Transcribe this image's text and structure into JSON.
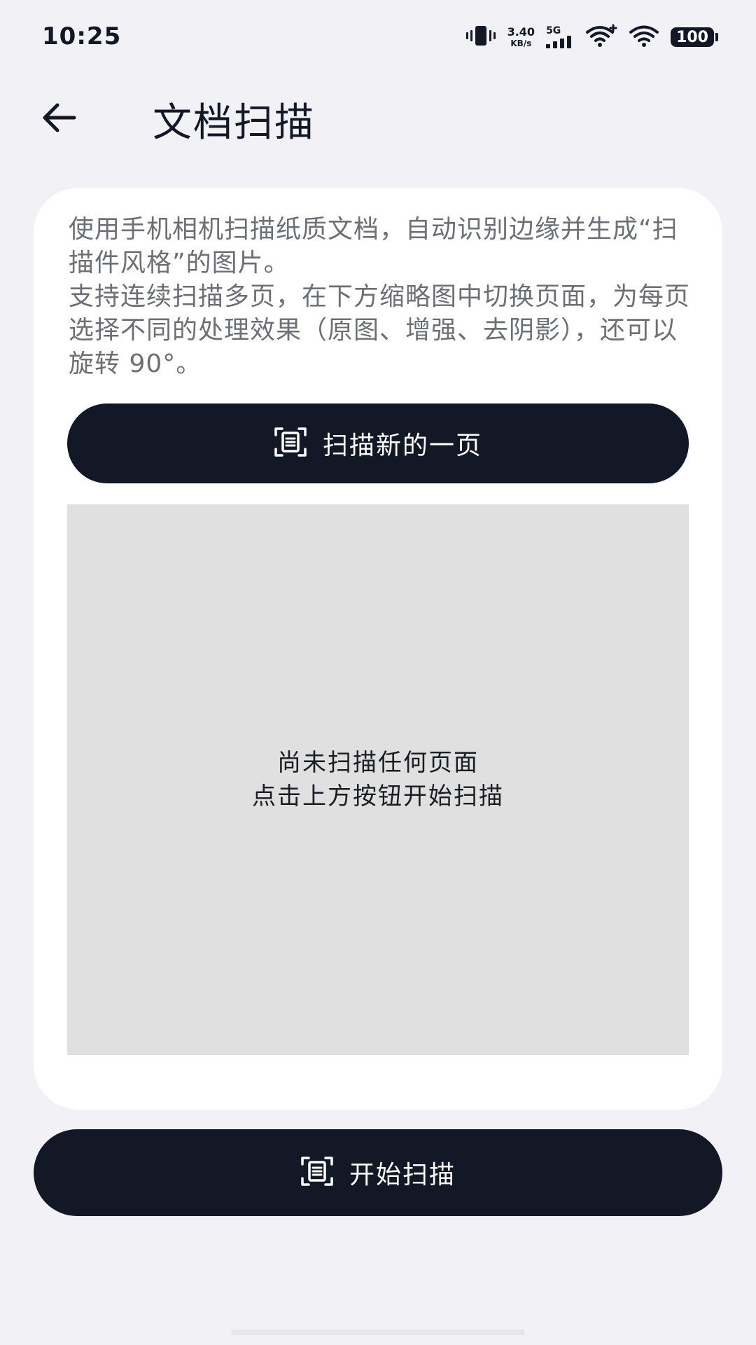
{
  "status_bar": {
    "time": "10:25",
    "net_speed_value": "3.40",
    "net_speed_unit": "KB/s",
    "network_type": "5G",
    "battery": "100"
  },
  "header": {
    "title": "文档扫描"
  },
  "card": {
    "description_lines": [
      "使用手机相机扫描纸质文档，自动识别边缘并生成“扫描件风格”的图片。",
      "支持连续扫描多页，在下方缩略图中切换页面，为每页选择不同的处理效果（原图、增强、去阴影），还可以旋转 90°。"
    ],
    "scan_new_label": "扫描新的一页",
    "empty_state_line1": "尚未扫描任何页面",
    "empty_state_line2": "点击上方按钮开始扫描"
  },
  "footer": {
    "start_scan_label": "开始扫描"
  },
  "icons": {
    "back": "arrow-left-icon",
    "scan": "document-scan-icon"
  },
  "colors": {
    "background": "#f1f1f6",
    "primary_button": "#121826",
    "preview_background": "#e0e0e0",
    "description_text": "#6d6f76"
  }
}
